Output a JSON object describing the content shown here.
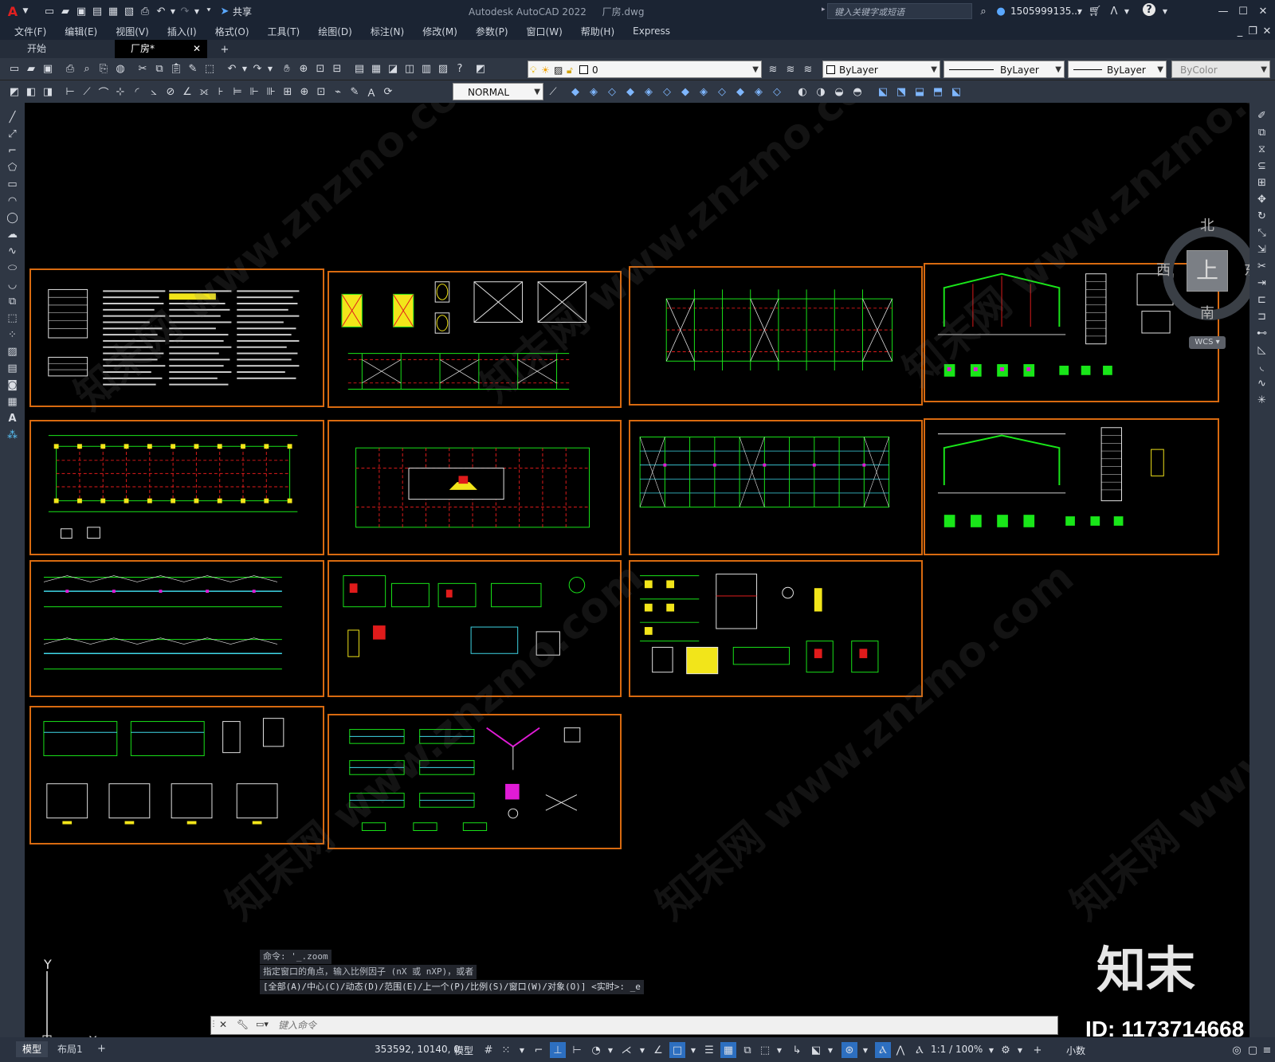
{
  "app": {
    "title": "Autodesk AutoCAD 2022",
    "filename": "厂房.dwg",
    "share_label": "共享",
    "search_placeholder": "键入关键字或短语",
    "user": "1505999135...",
    "help_icon": "?"
  },
  "menu": [
    "文件(F)",
    "编辑(E)",
    "视图(V)",
    "插入(I)",
    "格式(O)",
    "工具(T)",
    "绘图(D)",
    "标注(N)",
    "修改(M)",
    "参数(P)",
    "窗口(W)",
    "帮助(H)",
    "Express"
  ],
  "tabs": [
    {
      "label": "开始",
      "active": false
    },
    {
      "label": "厂房*",
      "active": true
    }
  ],
  "toolbar": {
    "layer_value": "0",
    "color_value": "ByLayer",
    "linetype_value": "ByLayer",
    "lineweight_value": "ByLayer",
    "plotstyle_value": "ByColor",
    "dimstyle_value": "NORMAL"
  },
  "viewcube": {
    "north": "北",
    "south": "南",
    "east": "东",
    "west": "西",
    "face": "上",
    "wcs": "WCS"
  },
  "ucs": {
    "y": "Y",
    "x": "X"
  },
  "command": {
    "history": [
      "命令: '_.zoom",
      "指定窗口的角点，输入比例因子 (nX 或 nXP)，或者",
      "[全部(A)/中心(C)/动态(D)/范围(E)/上一个(P)/比例(S)/窗口(W)/对象(O)] <实时>: _e"
    ],
    "placeholder": "键入命令"
  },
  "status": {
    "layout_tabs": [
      "模型",
      "布局1"
    ],
    "add_tab": "+",
    "coordinates": "353592, 10140, 0",
    "mode": "模型",
    "scale": "1:1 / 100%",
    "units": "小数"
  },
  "overlay": {
    "brand": "知末",
    "id_text": "ID: 1173714668",
    "watermark": "知末网 www.znzmo.com"
  },
  "colors": {
    "sheet_border": "#d86a10",
    "green": "#19e619",
    "red": "#e01b1b",
    "yellow": "#f2e51a",
    "cyan": "#3fd7e8",
    "magenta": "#e01bd6",
    "white": "#e6e6e6"
  }
}
